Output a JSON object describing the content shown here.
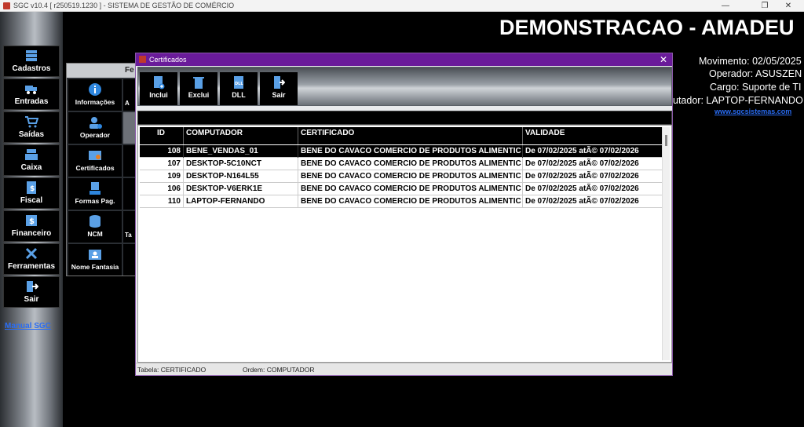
{
  "window": {
    "title": "SGC v10.4 [ r250519.1230 ] - SISTEMA DE GESTÃO DE COMÉRCIO"
  },
  "sidebar": {
    "items": [
      {
        "label": "Cadastros"
      },
      {
        "label": "Entradas"
      },
      {
        "label": "Saídas"
      },
      {
        "label": "Caixa"
      },
      {
        "label": "Fiscal"
      },
      {
        "label": "Financeiro"
      },
      {
        "label": "Ferramentas"
      },
      {
        "label": "Sair"
      }
    ],
    "manual_link": "Manual SGC"
  },
  "header": {
    "title": "DEMONSTRACAO - AMADEU",
    "movimento": "Movimento: 02/05/2025",
    "operador": "Operador: ASUSZEN",
    "cargo": "Cargo: Suporte de TI",
    "computador": "utador: LAPTOP-FERNANDO",
    "site_link": "www.sgcsistemas.com"
  },
  "bg_panel": {
    "header": "Fe",
    "tiles": [
      {
        "label": "Informações",
        "side": "A"
      },
      {
        "label": "Operador",
        "side": ""
      },
      {
        "label": "Certificados",
        "side": ""
      },
      {
        "label": "Formas Pag.",
        "side": ""
      },
      {
        "label": "NCM",
        "side": "Ta"
      },
      {
        "label": "Nome Fantasia",
        "side": ""
      }
    ]
  },
  "dialog": {
    "title": "Certificados",
    "toolbar": {
      "inclui": "Inclui",
      "exclui": "Exclui",
      "dll": "DLL",
      "sair": "Sair"
    },
    "columns": {
      "id": "ID",
      "computador": "COMPUTADOR",
      "certificado": "CERTIFICADO",
      "validade": "VALIDADE"
    },
    "rows": [
      {
        "id": "108",
        "computador": "BENE_VENDAS_01",
        "certificado": "BENE DO CAVACO COMERCIO DE PRODUTOS ALIMENTIC",
        "validade": "De 07/02/2025 atÃ© 07/02/2026"
      },
      {
        "id": "107",
        "computador": "DESKTOP-5C10NCT",
        "certificado": "BENE DO CAVACO COMERCIO DE PRODUTOS ALIMENTIC",
        "validade": "De 07/02/2025 atÃ© 07/02/2026"
      },
      {
        "id": "109",
        "computador": "DESKTOP-N164L55",
        "certificado": "BENE DO CAVACO COMERCIO DE PRODUTOS ALIMENTIC",
        "validade": "De 07/02/2025 atÃ© 07/02/2026"
      },
      {
        "id": "106",
        "computador": "DESKTOP-V6ERK1E",
        "certificado": "BENE DO CAVACO COMERCIO DE PRODUTOS ALIMENTIC",
        "validade": "De 07/02/2025 atÃ© 07/02/2026"
      },
      {
        "id": "110",
        "computador": "LAPTOP-FERNANDO",
        "certificado": "BENE DO CAVACO COMERCIO DE PRODUTOS ALIMENTIC",
        "validade": "De 07/02/2025 atÃ© 07/02/2026"
      }
    ],
    "status": {
      "tabela": "Tabela: CERTIFICADO",
      "ordem": "Ordem: COMPUTADOR"
    }
  }
}
